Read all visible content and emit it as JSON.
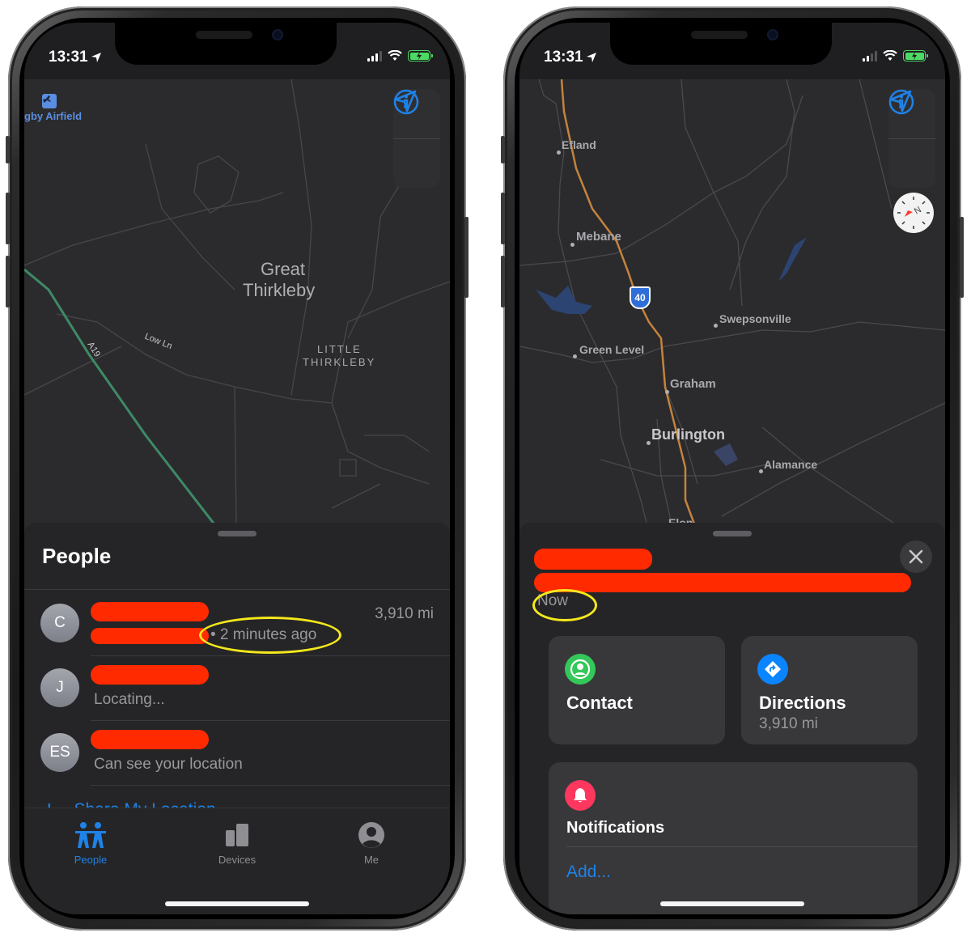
{
  "status_bar": {
    "time": "13:31",
    "location_arrow_icon": "location-arrow-icon",
    "signal_icon": "cellular-signal-icon",
    "wifi_icon": "wifi-icon",
    "battery_icon": "battery-charging-icon",
    "battery_color": "#4cd964"
  },
  "left_screen": {
    "map": {
      "airport_label": "gby Airfield",
      "town_label_1": "Great",
      "town_label_2": "Thirkleby",
      "village_label_1": "LITTLE",
      "village_label_2": "THIRKLEBY",
      "road_label_low_ln": "Low Ln",
      "road_label_a19": "A19",
      "info_icon": "info-icon",
      "locate_icon": "location-arrow-icon",
      "a19_color": "#3e8a66"
    },
    "sheet": {
      "title": "People",
      "people": [
        {
          "initials": "C",
          "subtitle": "• 2 minutes ago",
          "distance": "3,910 mi",
          "highlighted": true
        },
        {
          "initials": "J",
          "subtitle": "Locating...",
          "distance": ""
        },
        {
          "initials": "ES",
          "subtitle": "Can see your location",
          "distance": ""
        }
      ],
      "share_plus": "+",
      "share_label": "Share My Location"
    },
    "tabs": [
      {
        "label": "People",
        "icon": "people-icon",
        "active": true
      },
      {
        "label": "Devices",
        "icon": "devices-icon",
        "active": false
      },
      {
        "label": "Me",
        "icon": "me-person-icon",
        "active": false
      }
    ]
  },
  "right_screen": {
    "map": {
      "towns": [
        "Efland",
        "Mebane",
        "Swepsonville",
        "Green Level",
        "Graham",
        "Burlington",
        "Alamance",
        "Elon"
      ],
      "interstate_shield": "40",
      "highway_color": "#c4833d",
      "info_icon": "info-icon",
      "locate_icon": "location-arrow-icon",
      "compass_icon": "compass-icon",
      "compass_letter": "N"
    },
    "detail": {
      "timestamp": "Now",
      "close_icon": "close-icon",
      "contact_label": "Contact",
      "contact_icon": "contact-person-icon",
      "contact_color": "#34c759",
      "directions_label": "Directions",
      "directions_distance": "3,910 mi",
      "directions_icon": "directions-icon",
      "directions_color": "#0a84ff",
      "notifications_label": "Notifications",
      "notifications_icon": "bell-icon",
      "notifications_color": "#ff375f",
      "add_label": "Add..."
    }
  },
  "colors": {
    "accent_blue": "#1e82e8",
    "redaction_red": "#ff2a00",
    "highlight_yellow": "#f4e81c",
    "sheet_background": "#252527",
    "map_background": "#2b2b2d"
  }
}
